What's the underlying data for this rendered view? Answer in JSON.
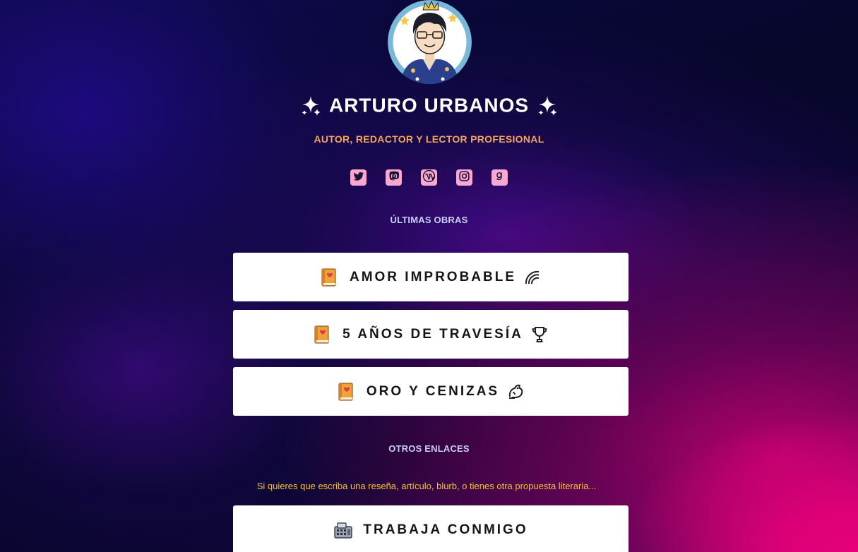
{
  "profile": {
    "name": "ARTURO URBANOS",
    "tagline": "AUTOR, REDACTOR Y LECTOR PROFESIONAL"
  },
  "socials": [
    {
      "name": "twitter",
      "icon": "twitter-icon"
    },
    {
      "name": "mastodon",
      "icon": "mastodon-icon"
    },
    {
      "name": "wordpress",
      "icon": "wordpress-icon"
    },
    {
      "name": "instagram",
      "icon": "instagram-icon"
    },
    {
      "name": "goodreads",
      "icon": "goodreads-icon"
    }
  ],
  "sections": {
    "works_title": "ÚLTIMAS OBRAS",
    "other_title": "OTROS ENLACES"
  },
  "works": [
    {
      "label": "AMOR IMPROBABLE",
      "left_icon": "book-icon",
      "right_icon": "rainbow-icon"
    },
    {
      "label": "5 AÑOS DE TRAVESÍA",
      "left_icon": "book-icon",
      "right_icon": "trophy-icon"
    },
    {
      "label": "ORO Y CENIZAS",
      "left_icon": "book-icon",
      "right_icon": "dragon-icon"
    }
  ],
  "other_links": {
    "note": "Si quieres que escriba una reseña, artículo, blurb, o tienes otra propuesta literaria...",
    "work_with_me": {
      "label": "TRABAJA CONMIGO",
      "icon": "cash-register-icon"
    }
  },
  "colors": {
    "tagline": "#f5a561",
    "section_title": "#c9cdfa",
    "note": "#f3c237",
    "social_bg": "#f9a8d4",
    "card_bg": "#ffffff"
  }
}
